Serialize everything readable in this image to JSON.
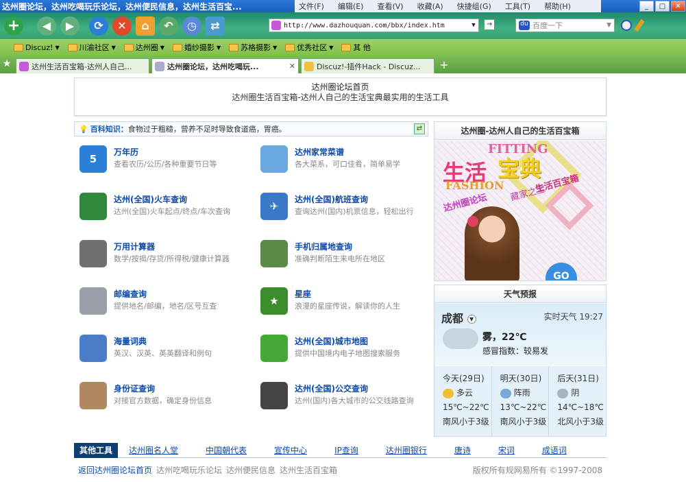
{
  "window": {
    "title": "达州圈论坛，达州吃喝玩乐论坛，达州便民信息，达州生活百宝...",
    "menu": [
      "文件(F)",
      "编辑(E)",
      "查看(V)",
      "收藏(A)",
      "快捷组(G)",
      "工具(T)",
      "帮助(H)"
    ]
  },
  "toolbar": {
    "url": "http://www.dazhouquan.com/bbx/index.htm",
    "search_placeholder": "百度一下"
  },
  "bookmarks": [
    "Discuz!",
    "川渝社区",
    "达州圈",
    "婚纱摄影",
    "苏格摄影",
    "优秀社区",
    "其 他"
  ],
  "tabs": [
    {
      "label": "达州生活百宝箱-达州人自己..."
    },
    {
      "label": "达州圈论坛，达州吃喝玩..."
    },
    {
      "label": "Discuz!-插件Hack - Discuz..."
    }
  ],
  "header": {
    "title": "达州圈论坛首页",
    "subtitle": "达州圈生活百宝箱-达州人自己的生活宝典最实用的生活工具"
  },
  "knowledge": {
    "label": "百科知识：",
    "text": "食物过于粗糙，营养不足时导致食道癌，胃癌。"
  },
  "tools": [
    {
      "title": "万年历",
      "desc": "查看农历/公历/各种重要节日等",
      "icon": "calendar-icon",
      "icon_text": "5",
      "color": "#2a7fd6"
    },
    {
      "title": "达州家常菜谱",
      "desc": "各大菜系，可口佳肴，简单易学",
      "icon": "chef-hat-icon",
      "icon_text": "",
      "color": "#6aa8e0"
    },
    {
      "title": "达州(全国)火车查询",
      "desc": "达州(全国)火车起点/终点/车次查询",
      "icon": "train-icon",
      "icon_text": "",
      "color": "#2e8a3a"
    },
    {
      "title": "达州(全国)航班查询",
      "desc": "查询达州(国内)机票信息，轻松出行",
      "icon": "airplane-icon",
      "icon_text": "✈",
      "color": "#3a78c8"
    },
    {
      "title": "万用计算器",
      "desc": "数学/按揭/存贷/所得税/健康计算器",
      "icon": "calculator-icon",
      "icon_text": "",
      "color": "#707070"
    },
    {
      "title": "手机归属地查询",
      "desc": "准确判断陌生来电所在地区",
      "icon": "mobile-phone-icon",
      "icon_text": "",
      "color": "#5a8a48"
    },
    {
      "title": "邮编查询",
      "desc": "提供地名/邮编，地名/区号互查",
      "icon": "magnifier-icon",
      "icon_text": "",
      "color": "#9aa0a8"
    },
    {
      "title": "星座",
      "desc": "浪漫的星座传说，解读你的人生",
      "icon": "star-book-icon",
      "icon_text": "★",
      "color": "#3c8c2c"
    },
    {
      "title": "海量词典",
      "desc": "英汉、汉英、英英翻译和例句",
      "icon": "dictionary-icon",
      "icon_text": "",
      "color": "#4a7cc8"
    },
    {
      "title": "达州(全国)城市地图",
      "desc": "提供中国境内电子地图搜索服务",
      "icon": "china-map-icon",
      "icon_text": "",
      "color": "#46a836"
    },
    {
      "title": "身份证查询",
      "desc": "对接官方数据，确定身份信息",
      "icon": "id-card-icon",
      "icon_text": "",
      "color": "#b08860"
    },
    {
      "title": "达州(全国)公交查询",
      "desc": "达州(国内)各大城市的公交线路查询",
      "icon": "bus-icon",
      "icon_text": "",
      "color": "#444"
    }
  ],
  "promo": {
    "header": "达州圈-达州人自己的生活百宝箱",
    "big1": "生活",
    "big2": "宝典",
    "fitting": "FITTING",
    "fashion": "FASHION",
    "tag1": "达州圈论坛",
    "tag2": "藏家之宝",
    "tag3": "生活百宝箱",
    "go": "GO"
  },
  "weather": {
    "header": "天气预报",
    "city": "成都",
    "realtime": "实时天气 19:27",
    "condition": "雾，22℃",
    "index": "感冒指数：较易发",
    "days": [
      {
        "day": "今天(29日)",
        "cond": "多云",
        "temp": "15℃~22℃",
        "wind": "南风小于3级",
        "color": "#f0c030"
      },
      {
        "day": "明天(30日)",
        "cond": "阵雨",
        "temp": "13℃~22℃",
        "wind": "南风小于3级",
        "color": "#7aa8d8"
      },
      {
        "day": "后天(31日)",
        "cond": "阴",
        "temp": "14℃~18℃",
        "wind": "北风小于3级",
        "color": "#a8b4c0"
      }
    ]
  },
  "footer": {
    "label": "其他工具",
    "links": [
      "达州圈名人堂",
      "中国朝代表",
      "宣传中心",
      "IP查询",
      "达州圈银行",
      "唐诗",
      "宋词",
      "成语词"
    ],
    "back": "返回达州圈论坛首页",
    "tags": [
      "达州吃喝玩乐论坛",
      "达州便民信息",
      "达州生活百宝箱"
    ],
    "copyright": "版权所有规网易所有 ©1997-2008"
  }
}
